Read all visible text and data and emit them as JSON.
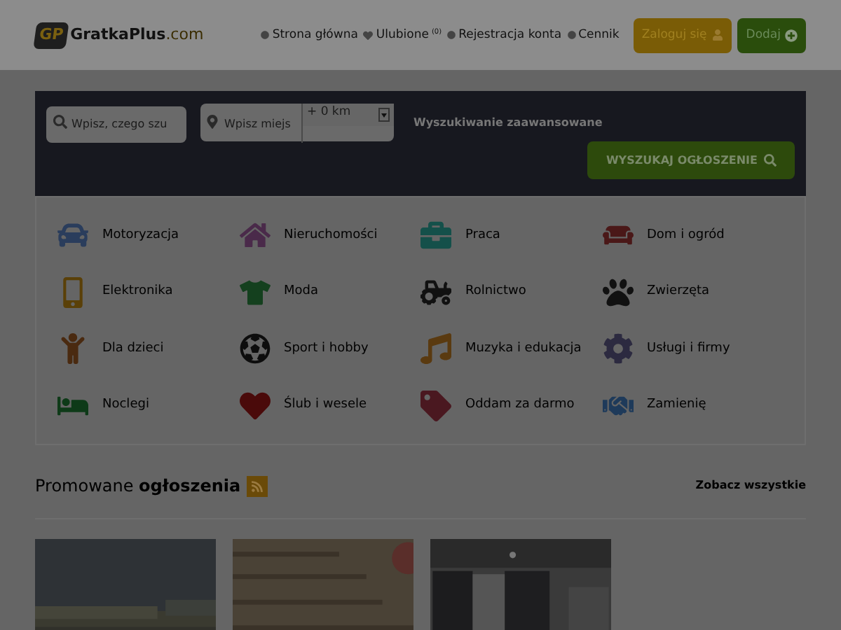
{
  "header": {
    "logo_badge": "GP",
    "logo_name": "GratkaPlus",
    "logo_tld": ".com",
    "nav": [
      {
        "label": "Strona główna",
        "kind": "dot"
      },
      {
        "label": "Ulubione",
        "kind": "heart",
        "count": "(0)"
      },
      {
        "label": "Rejestracja konta",
        "kind": "dot"
      },
      {
        "label": "Cennik",
        "kind": "dot"
      }
    ],
    "login_button": "Zaloguj się",
    "add_button": "Dodaj"
  },
  "search": {
    "query_placeholder": "Wpisz, czego szu",
    "location_placeholder": "Wpisz miejs",
    "distance": "+ 0 km",
    "advanced_link": "Wyszukiwanie zaawansowane",
    "submit": "WYSZUKAJ OGŁOSZENIE"
  },
  "categories": [
    {
      "label": "Motoryzacja",
      "color": "#2a3d5c"
    },
    {
      "label": "Nieruchomości",
      "color": "#4a2a4a"
    },
    {
      "label": "Praca",
      "color": "#14504a"
    },
    {
      "label": "Dom i ogród",
      "color": "#4a1818"
    },
    {
      "label": "Elektronika",
      "color": "#5a4008"
    },
    {
      "label": "Moda",
      "color": "#14401e"
    },
    {
      "label": "Rolnictwo",
      "color": "#111111"
    },
    {
      "label": "Zwierzęta",
      "color": "#111111"
    },
    {
      "label": "Dla dzieci",
      "color": "#4a2a10"
    },
    {
      "label": "Sport i hobby",
      "color": "#0d0d0d"
    },
    {
      "label": "Muzyka i edukacja",
      "color": "#5a3a10"
    },
    {
      "label": "Usługi i firmy",
      "color": "#2c2a40"
    },
    {
      "label": "Noclegi",
      "color": "#0e3a18"
    },
    {
      "label": "Ślub i wesele",
      "color": "#4a0a0a"
    },
    {
      "label": "Oddam za darmo",
      "color": "#4a1820"
    },
    {
      "label": "Zamienię",
      "color": "#1e3a5a"
    }
  ],
  "promoted": {
    "title": "Promowane **ogłoszenia**",
    "see_all": "Zobacz wszystkie"
  }
}
